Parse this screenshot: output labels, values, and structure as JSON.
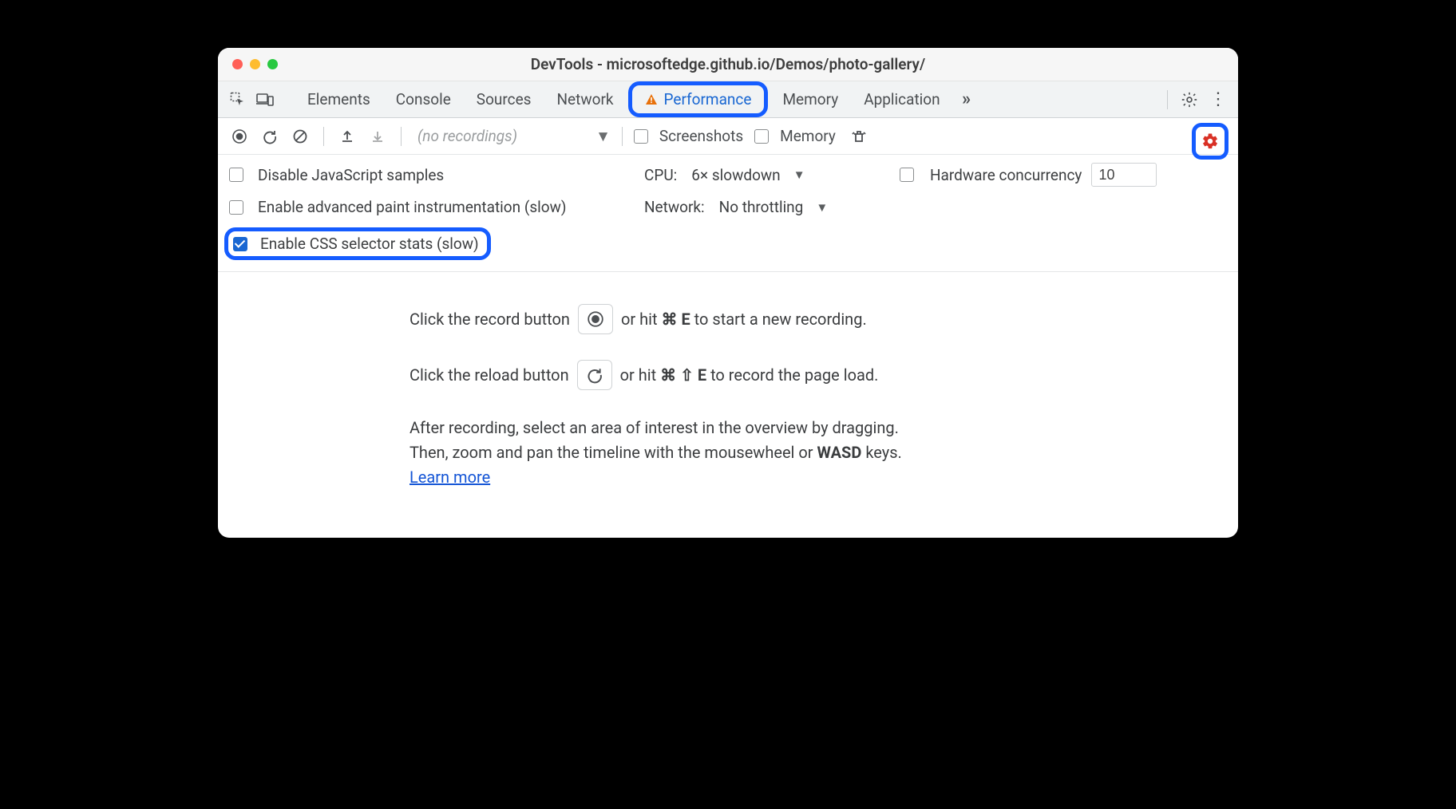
{
  "title": "DevTools - microsoftedge.github.io/Demos/photo-gallery/",
  "tabs": {
    "items": [
      "Elements",
      "Console",
      "Sources",
      "Network",
      "Performance",
      "Memory",
      "Application"
    ],
    "activeIndex": 4
  },
  "toolbar": {
    "no_recordings": "(no recordings)",
    "screenshots_label": "Screenshots",
    "memory_label": "Memory"
  },
  "settings": {
    "disable_js_samples": "Disable JavaScript samples",
    "enable_paint_instr": "Enable advanced paint instrumentation (slow)",
    "enable_css_stats": "Enable CSS selector stats (slow)",
    "cpu_label": "CPU:",
    "cpu_value": "6× slowdown",
    "network_label": "Network:",
    "network_value": "No throttling",
    "hardware_label": "Hardware concurrency",
    "hardware_value": "10"
  },
  "instructions": {
    "record_prefix": "Click the record button",
    "record_suffix_1": "or hit ",
    "record_key": "⌘ E",
    "record_suffix_2": " to start a new recording.",
    "reload_prefix": "Click the reload button",
    "reload_suffix_1": "or hit ",
    "reload_key": "⌘ ⇧ E",
    "reload_suffix_2": " to record the page load.",
    "para1": "After recording, select an area of interest in the overview by dragging.",
    "para2_a": "Then, zoom and pan the timeline with the mousewheel or ",
    "para2_key": "WASD",
    "para2_b": " keys.",
    "learn_more": "Learn more"
  }
}
